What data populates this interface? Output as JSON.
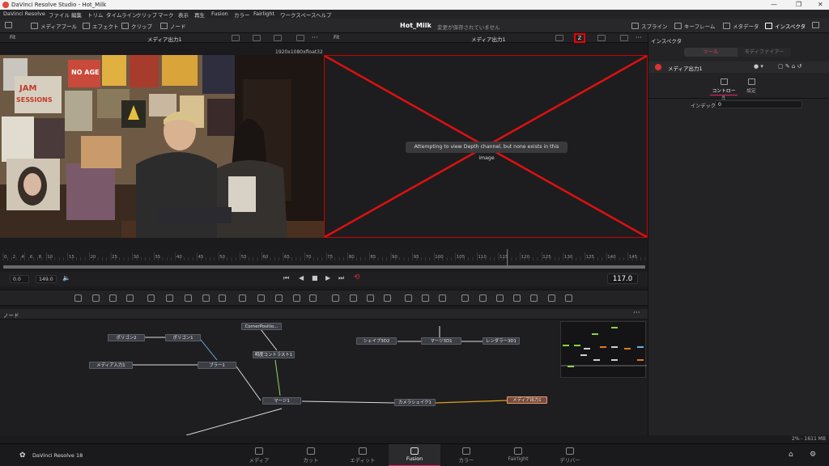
{
  "window": {
    "title": "DaVinci Resolve Studio - Hot_Milk"
  },
  "menu": [
    "DaVinci Resolve",
    "ファイル",
    "編集",
    "トリム",
    "タイムライン",
    "クリップ",
    "マーク",
    "表示",
    "再生",
    "Fusion",
    "カラー",
    "Fairlight",
    "ワークスペース",
    "ヘルプ"
  ],
  "toolbar": {
    "left": [
      "メディアプール",
      "エフェクト",
      "クリップ",
      "ノード"
    ],
    "project": "Hot_Milk",
    "status": "変更が保存されていません",
    "right": [
      "スプライン",
      "キーフレーム",
      "メタデータ",
      "インスペクタ"
    ]
  },
  "viewer_left": {
    "fit": "Fit",
    "title": "メディア出力1",
    "resolution": "1920x1080xfloat32"
  },
  "viewer_right": {
    "fit": "Fit",
    "title": "メディア出力1",
    "channel": "Z",
    "message": "Attempting to view Depth channel, but none exists in this image"
  },
  "ruler": {
    "ticks": [
      "0",
      "2",
      "4",
      "6",
      "8",
      "10",
      "15",
      "20",
      "25",
      "30",
      "35",
      "40",
      "45",
      "50",
      "55",
      "60",
      "65",
      "70",
      "75",
      "80",
      "85",
      "90",
      "95",
      "100",
      "105",
      "110",
      "115",
      "120",
      "125",
      "130",
      "135",
      "140",
      "145"
    ]
  },
  "transport": {
    "start": "0.0",
    "end": "149.0",
    "current": "117.0"
  },
  "inspector": {
    "title": "インスペクタ",
    "tabs": [
      "ツール",
      "モディファイアー"
    ],
    "node": "メディア出力1",
    "subtabs": [
      "コントロール",
      "設定"
    ],
    "field_label": "インデックス",
    "field_value": "0"
  },
  "nodes_panel": {
    "title": "ノード",
    "nodes": {
      "polygon2": "ポリゴン2",
      "polygon1": "ポリゴン1",
      "corner": "CornerPositio...",
      "bc": "明度コントラスト1",
      "mediain": "メディア入力1",
      "blur": "ブラー1",
      "merge1": "マージ1",
      "shape3d": "シェイプ3D2",
      "merge3d": "マージ3D1",
      "renderer": "レンダラー3D1",
      "camerashake": "カメラシェイク1",
      "mediaout": "メディア出力1"
    },
    "zoom_status": "2% - 1611 MB"
  },
  "pages": [
    "メディア",
    "カット",
    "エディット",
    "Fusion",
    "カラー",
    "Fairlight",
    "デリバー"
  ],
  "app_name": "DaVinci Resolve 18"
}
